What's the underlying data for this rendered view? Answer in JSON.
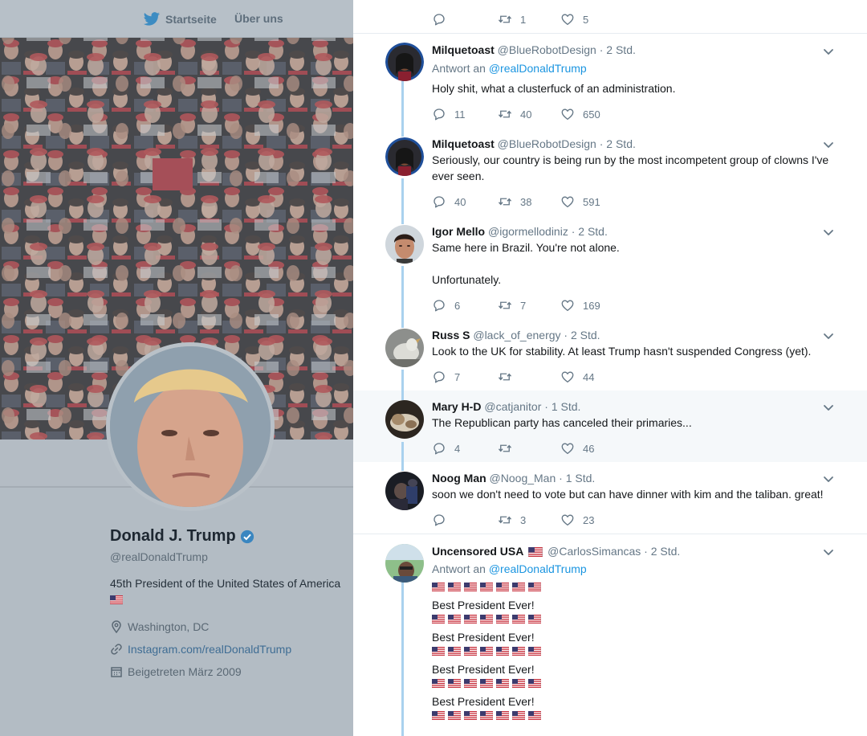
{
  "nav": {
    "home_label": "Startseite",
    "about_label": "Über uns"
  },
  "profile": {
    "name": "Donald J. Trump",
    "handle": "@realDonaldTrump",
    "bio": "45th President of the United States of America",
    "location": "Washington, DC",
    "link": "Instagram.com/realDonaldTrump",
    "joined": "Beigetreten März 2009"
  },
  "top_actions": {
    "replies": "",
    "retweets": "1",
    "likes": "5"
  },
  "tweets": [
    {
      "name": "Milquetoast",
      "handle": "@BlueRobotDesign",
      "time": "2 Std.",
      "reply_prefix": "Antwort an",
      "reply_to": "@realDonaldTrump",
      "text": "Holy shit, what a clusterfuck of an administration.",
      "replies": "11",
      "retweets": "40",
      "likes": "650"
    },
    {
      "name": "Milquetoast",
      "handle": "@BlueRobotDesign",
      "time": "2 Std.",
      "text": "Seriously, our country is being run by the most incompetent group of clowns I've ever seen.",
      "replies": "40",
      "retweets": "38",
      "likes": "591"
    },
    {
      "name": "Igor Mello",
      "handle": "@igormellodiniz",
      "time": "2 Std.",
      "text": "Same here in Brazil. You're not alone.",
      "text2": "Unfortunately.",
      "replies": "6",
      "retweets": "7",
      "likes": "169"
    },
    {
      "name": "Russ S",
      "handle": "@lack_of_energy",
      "time": "2 Std.",
      "text": "Look to the UK for stability. At least Trump hasn't suspended Congress (yet).",
      "replies": "7",
      "retweets": "",
      "likes": "44"
    },
    {
      "name": "Mary H-D",
      "handle": "@catjanitor",
      "time": "1 Std.",
      "text": "The Republican party has canceled their primaries...",
      "replies": "4",
      "retweets": "",
      "likes": "46"
    },
    {
      "name": "Noog Man",
      "handle": "@Noog_Man",
      "time": "1 Std.",
      "text": "soon we don't need to vote but can have dinner with kim and the taliban. great!",
      "replies": "",
      "retweets": "3",
      "likes": "23"
    },
    {
      "name": "Uncensored USA",
      "handle": "@CarlosSimancas",
      "time": "2 Std.",
      "reply_prefix": "Antwort an",
      "reply_to": "@realDonaldTrump",
      "repeated_line": "Best President Ever!"
    }
  ],
  "colors": {
    "link_blue": "#1b95e0",
    "thread_line": "#a9d1ee",
    "verified": "#1da1f2",
    "highlight_bg": "#f5f8fa"
  },
  "icons": [
    "twitter-bird-icon",
    "verified-badge-icon",
    "location-icon",
    "link-icon",
    "calendar-icon",
    "reply-icon",
    "retweet-icon",
    "like-icon",
    "chevron-down-icon",
    "us-flag-icon"
  ]
}
